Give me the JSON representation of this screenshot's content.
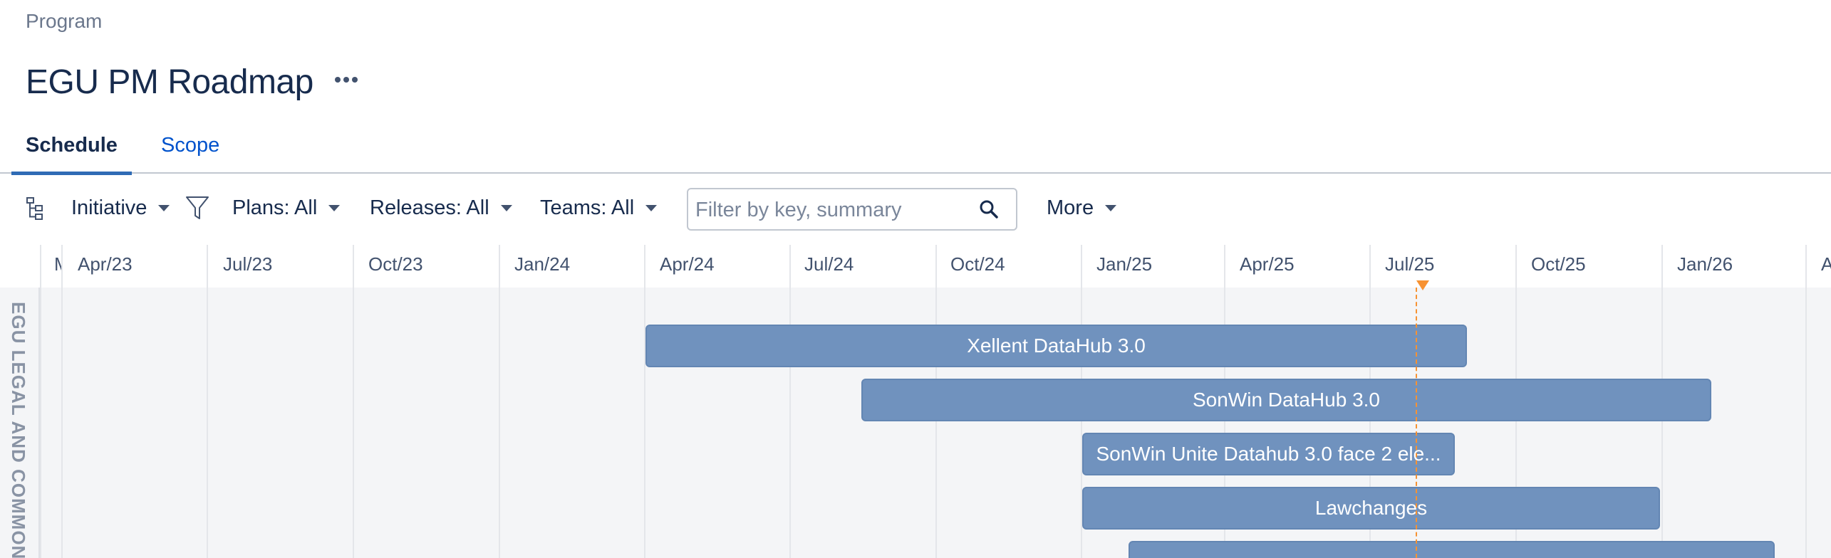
{
  "breadcrumb": "Program",
  "title": "EGU PM Roadmap",
  "tabs": [
    {
      "label": "Schedule",
      "active": true
    },
    {
      "label": "Scope",
      "active": false
    }
  ],
  "toolbar": {
    "hierarchy_icon": "hierarchy-icon",
    "group_by": "Initiative",
    "filter_icon": "filter-icon",
    "plans": "Plans: All",
    "releases": "Releases: All",
    "teams": "Teams: All",
    "search_placeholder": "Filter by key, summary",
    "more": "More"
  },
  "timeline": {
    "columns": [
      "M",
      "Apr/23",
      "Jul/23",
      "Oct/23",
      "Jan/24",
      "Apr/24",
      "Jul/24",
      "Oct/24",
      "Jan/25",
      "Apr/25",
      "Jul/25",
      "Oct/25",
      "Jan/26",
      "A"
    ],
    "today_color": "#f79232"
  },
  "group": {
    "label": "EGU LEGAL AND COMMON"
  },
  "bars": [
    {
      "label": "Xellent DataHub 3.0"
    },
    {
      "label": "SonWin DataHub 3.0"
    },
    {
      "label": "SonWin Unite Datahub 3.0 face 2 ele..."
    },
    {
      "label": "Lawchanges"
    },
    {
      "label": ""
    }
  ],
  "colors": {
    "bar": "#7092be",
    "accent": "#2f6bb5",
    "link": "#0052cc"
  }
}
